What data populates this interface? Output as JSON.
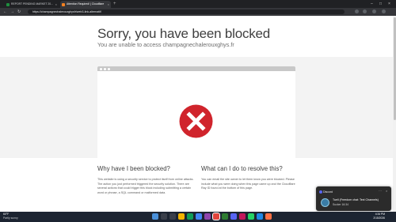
{
  "browser": {
    "tabs": [
      {
        "label": "REPORT PENDING MARKET 20..."
      },
      {
        "label": "Attention Required! | Cloudflare"
      }
    ],
    "new_tab": "+",
    "address": "https://champagnechalerouxghysfr/web3-link-alternatif/"
  },
  "page": {
    "title": "Sorry, you have been blocked",
    "subtitle": "You are unable to access champagnechalerouxghys.fr",
    "why_heading": "Why have I been blocked?",
    "why_text": "This website is using a security service to protect itself from online attacks. The action you just performed triggered the security solution. There are several actions that could trigger this block including submitting a certain word or phrase, a SQL command or malformed data.",
    "resolve_heading": "What can I do to resolve this?",
    "resolve_text": "You can email the site owner to let them know you were blocked. Please include what you were doing when this page came up and the Cloudflare Ray ID found at the bottom of this page."
  },
  "notification": {
    "app": "Discord",
    "title": "Tuell (Freedom chat: Text Channels)",
    "body": "Sucker 16:34"
  },
  "taskbar": {
    "weather_temp": "60°F",
    "weather_desc": "Partly sunny",
    "time": "4:34 PM",
    "date": "2/15/2026"
  },
  "colors": {
    "stop_red": "#d0242c",
    "tab_bg": "#202124",
    "toolbar_bg": "#35363a",
    "taskbar_bg": "#1c2431",
    "notif_bg": "#2b2b2b"
  }
}
